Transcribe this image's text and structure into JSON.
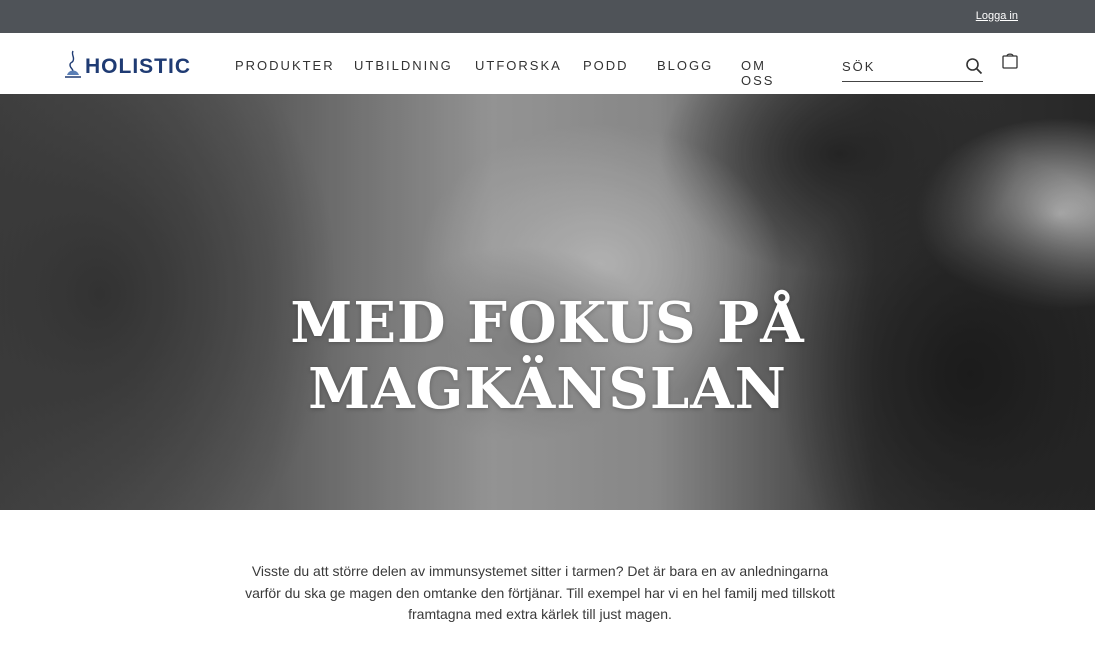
{
  "topbar": {
    "login_label": "Logga in"
  },
  "header": {
    "logo_text": "HOLISTIC",
    "brand_color": "#1f3b73",
    "nav": [
      {
        "label": "PRODUKTER"
      },
      {
        "label": "UTBILDNING"
      },
      {
        "label": "UTFORSKA"
      },
      {
        "label": "PODD"
      },
      {
        "label": "BLOGG"
      },
      {
        "label": "OM OSS"
      }
    ],
    "search": {
      "placeholder": "SÖK",
      "value": "",
      "icon": "search-icon"
    },
    "cart": {
      "icon": "cart-icon"
    }
  },
  "hero": {
    "title_line1": "MED FOKUS PÅ",
    "title_line2": "MAGKÄNSLAN",
    "image": "black-and-white photo of a smiling couple embracing"
  },
  "intro": {
    "text": "Visste du att större delen av immunsystemet sitter i tarmen? Det är bara en av anledningarna varför du ska ge magen den omtanke den förtjänar. Till exempel har vi en hel familj med tillskott framtagna med extra kärlek till just magen."
  },
  "colors": {
    "topbar": "#4f5358",
    "background": "#ffffff",
    "text": "#3a3a3a"
  }
}
